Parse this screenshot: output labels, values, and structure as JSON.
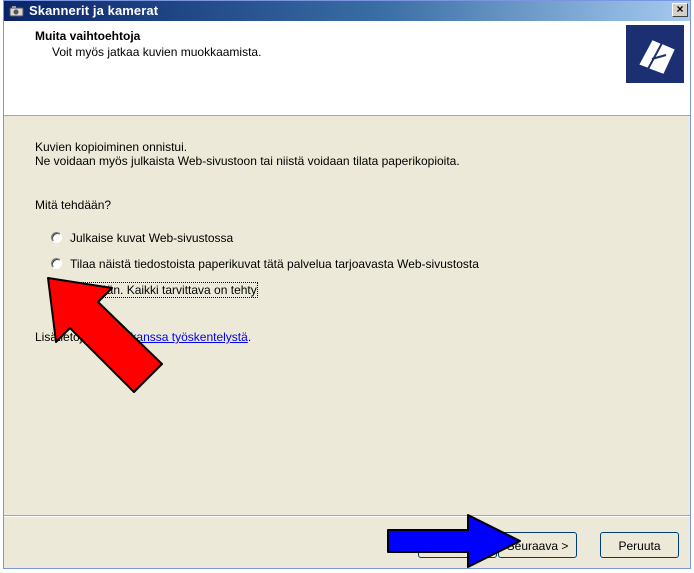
{
  "window": {
    "title": "Skannerit ja kamerat",
    "close_label": "×"
  },
  "header": {
    "title": "Muita vaihtoehtoja",
    "subtitle": "Voit myös jatkaa kuvien muokkaamista."
  },
  "body": {
    "line1": "Kuvien kopioiminen onnistui.",
    "line2": "Ne voidaan myös julkaista Web-sivustoon tai niistä voidaan tilata paperikopioita.",
    "question": "Mitä tehdään?",
    "options": [
      {
        "label": "Julkaise kuvat Web-sivustossa",
        "checked": false
      },
      {
        "label": "Tilaa näistä tiedostoista paperikuvat tätä palvelua tarjoavasta Web-sivustosta",
        "checked": false
      },
      {
        "label": "Ei mitään. Kaikki tarvittava on tehty",
        "checked": true
      }
    ],
    "info_prefix": "Lisätietoja",
    "info_link": "kuvien kanssa työskentelystä",
    "info_suffix": "."
  },
  "buttons": {
    "back": "",
    "next": "Seuraava >",
    "cancel": "Peruuta"
  },
  "colors": {
    "titlebar": "#0a246a",
    "dialog_bg": "#ece9d8",
    "red_arrow": "#ff0000",
    "blue_arrow": "#0000ff"
  }
}
